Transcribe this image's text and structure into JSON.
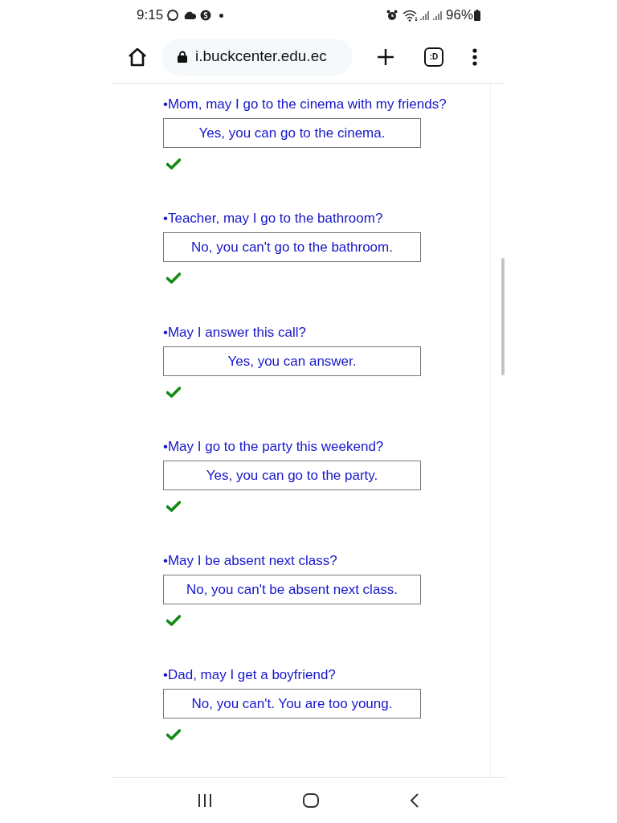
{
  "status_bar": {
    "time": "9:15",
    "battery": "96%"
  },
  "browser": {
    "url": "i.buckcenter.edu.ec",
    "tab_button": ":D"
  },
  "exercise": {
    "items": [
      {
        "question": "•Mom, may I go to the cinema with my friends?",
        "answer": "Yes, you can go to the cinema.",
        "correct": true
      },
      {
        "question": "•Teacher, may I go to the bathroom?",
        "answer": "No, you can't go to the bathroom.",
        "correct": true
      },
      {
        "question": "•May I answer this call?",
        "answer": "Yes, you can answer.",
        "correct": true
      },
      {
        "question": "•May I go to the party this weekend?",
        "answer": "Yes, you can go to the party.",
        "correct": true
      },
      {
        "question": "•May I be absent next class?",
        "answer": "No, you can't be absent next class.",
        "correct": true
      },
      {
        "question": "•Dad, may I get a boyfriend?",
        "answer": "No, you can't. You are too young.",
        "correct": true
      }
    ]
  }
}
